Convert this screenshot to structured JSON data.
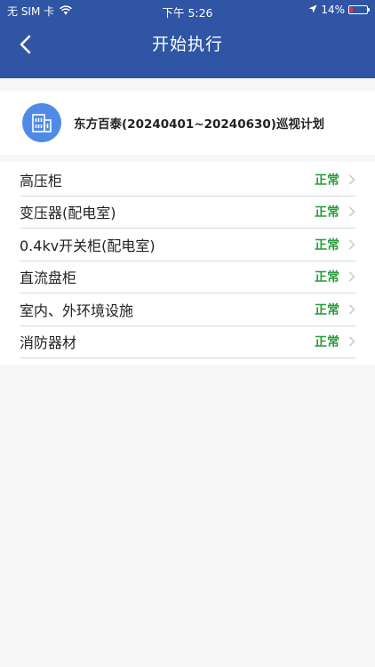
{
  "status_bar": {
    "carrier": "无 SIM 卡",
    "time": "下午 5:26",
    "battery_pct": "14%",
    "battery_level": 0.14,
    "icons": [
      "wifi-icon",
      "location-arrow-icon",
      "battery-icon"
    ]
  },
  "nav": {
    "title": "开始执行",
    "back_icon": "chevron-left-icon"
  },
  "plan": {
    "icon": "building-icon",
    "title": "东方百泰(20240401~20240630)巡视计划"
  },
  "items": [
    {
      "label": "高压柜",
      "status": "正常"
    },
    {
      "label": "变压器(配电室)",
      "status": "正常"
    },
    {
      "label": "0.4kv开关柜(配电室)",
      "status": "正常"
    },
    {
      "label": "直流盘柜",
      "status": "正常"
    },
    {
      "label": "室内、外环境设施",
      "status": "正常"
    },
    {
      "label": "消防器材",
      "status": "正常"
    }
  ],
  "colors": {
    "header_bg": "#2f55a4",
    "status_ok": "#2a9c3a",
    "icon_bg": "#4f8be6",
    "battery_low": "#e0363a"
  }
}
